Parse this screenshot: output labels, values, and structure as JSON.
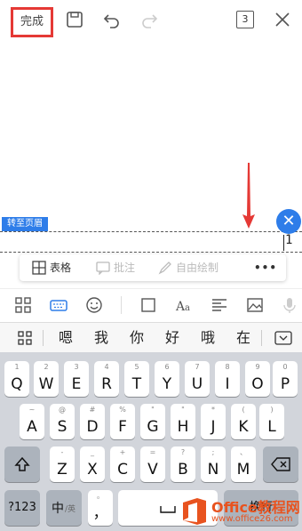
{
  "toolbar": {
    "done_label": "完成",
    "page_count": "3"
  },
  "header": {
    "goto_label": "转至页眉",
    "page_number": "1"
  },
  "floating_bar": {
    "table_label": "表格",
    "comment_label": "批注",
    "draw_label": "自由绘制",
    "more_label": "•••"
  },
  "candidates": [
    "嗯",
    "我",
    "你",
    "好",
    "哦",
    "在"
  ],
  "keyboard": {
    "row1": [
      {
        "alt": "1",
        "main": "Q"
      },
      {
        "alt": "2",
        "main": "W"
      },
      {
        "alt": "3",
        "main": "E"
      },
      {
        "alt": "4",
        "main": "R"
      },
      {
        "alt": "5",
        "main": "T"
      },
      {
        "alt": "6",
        "main": "Y"
      },
      {
        "alt": "7",
        "main": "U"
      },
      {
        "alt": "8",
        "main": "I"
      },
      {
        "alt": "9",
        "main": "O"
      },
      {
        "alt": "0",
        "main": "P"
      }
    ],
    "row2": [
      {
        "alt": "~",
        "main": "A"
      },
      {
        "alt": "@",
        "main": "S"
      },
      {
        "alt": "#",
        "main": "D"
      },
      {
        "alt": "%",
        "main": "F"
      },
      {
        "alt": "\"",
        "main": "G"
      },
      {
        "alt": "\"",
        "main": "H"
      },
      {
        "alt": "*",
        "main": "J"
      },
      {
        "alt": "(",
        "main": "K"
      },
      {
        "alt": ")",
        "main": "L"
      }
    ],
    "row3": [
      {
        "alt": "-",
        "main": "Z"
      },
      {
        "alt": "_",
        "main": "X"
      },
      {
        "alt": "+",
        "main": "C"
      },
      {
        "alt": "=",
        "main": "V"
      },
      {
        "alt": "?",
        "main": "B"
      },
      {
        "alt": ";",
        "main": "N"
      },
      {
        "alt": "、",
        "main": "M"
      }
    ],
    "num_label": "?123",
    "lang_label": "中",
    "lang_sub": "/英",
    "punct_label": "，",
    "punct_alt": "。",
    "enter_label": "换行"
  },
  "watermark": {
    "brand": "Office教程网",
    "url": "www.office26.com"
  },
  "colors": {
    "accent": "#2e7de9",
    "highlight": "#e53935"
  }
}
